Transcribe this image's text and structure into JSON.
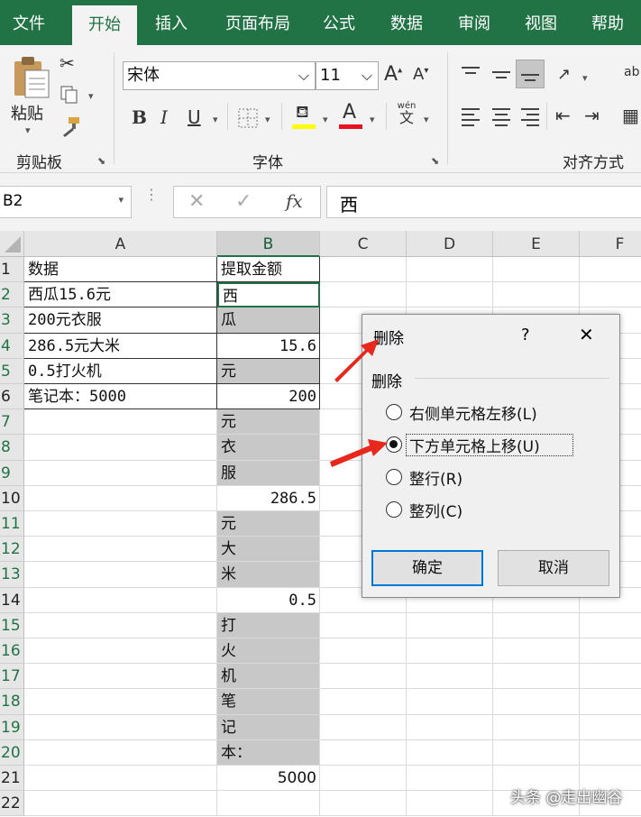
{
  "menu": {
    "tabs": [
      "文件",
      "开始",
      "插入",
      "页面布局",
      "公式",
      "数据",
      "审阅",
      "视图",
      "帮助"
    ],
    "active": "开始"
  },
  "ribbon": {
    "clipboard": {
      "paste_label": "粘贴",
      "group_label": "剪贴板"
    },
    "font": {
      "font_name": "宋体",
      "font_size": "11",
      "group_label": "字体",
      "bold": "B",
      "italic": "I",
      "underline": "U",
      "wen_top": "wén",
      "wen": "文"
    },
    "align": {
      "group_label": "对齐方式"
    }
  },
  "formula_bar": {
    "name_box": "B2",
    "fx": "fx",
    "content": "西"
  },
  "grid": {
    "columns": [
      "A",
      "B",
      "C",
      "D",
      "E",
      "F"
    ],
    "rows": [
      "1",
      "2",
      "3",
      "4",
      "5",
      "6",
      "7",
      "8",
      "9",
      "10",
      "11",
      "12",
      "13",
      "14",
      "15",
      "16",
      "17",
      "18",
      "19",
      "20",
      "21",
      "22"
    ],
    "colA": [
      "数据",
      "西瓜15.6元",
      "200元衣服",
      "286.5元大米",
      "0.5打火机",
      "笔记本：5000",
      "",
      "",
      "",
      "",
      "",
      "",
      "",
      "",
      "",
      "",
      "",
      "",
      "",
      "",
      "",
      ""
    ],
    "colB": [
      "提取金额",
      "西",
      "瓜",
      "15.6",
      "元",
      "200",
      "元",
      "衣",
      "服",
      "286.5",
      "元",
      "大",
      "米",
      "0.5",
      "打",
      "火",
      "机",
      "笔",
      "记",
      "本：",
      "5000",
      ""
    ]
  },
  "dialog": {
    "title": "删除",
    "help": "?",
    "close": "✕",
    "group": "删除",
    "options": [
      "右侧单元格左移(L)",
      "下方单元格上移(U)",
      "整行(R)",
      "整列(C)"
    ],
    "selected": "下方单元格上移(U)",
    "ok": "确定",
    "cancel": "取消"
  },
  "watermark": "头条 @走出幽谷",
  "colors": {
    "excel_green": "#217346",
    "arrow_red": "#e8281d",
    "selection_gray": "#c8c8c8"
  }
}
